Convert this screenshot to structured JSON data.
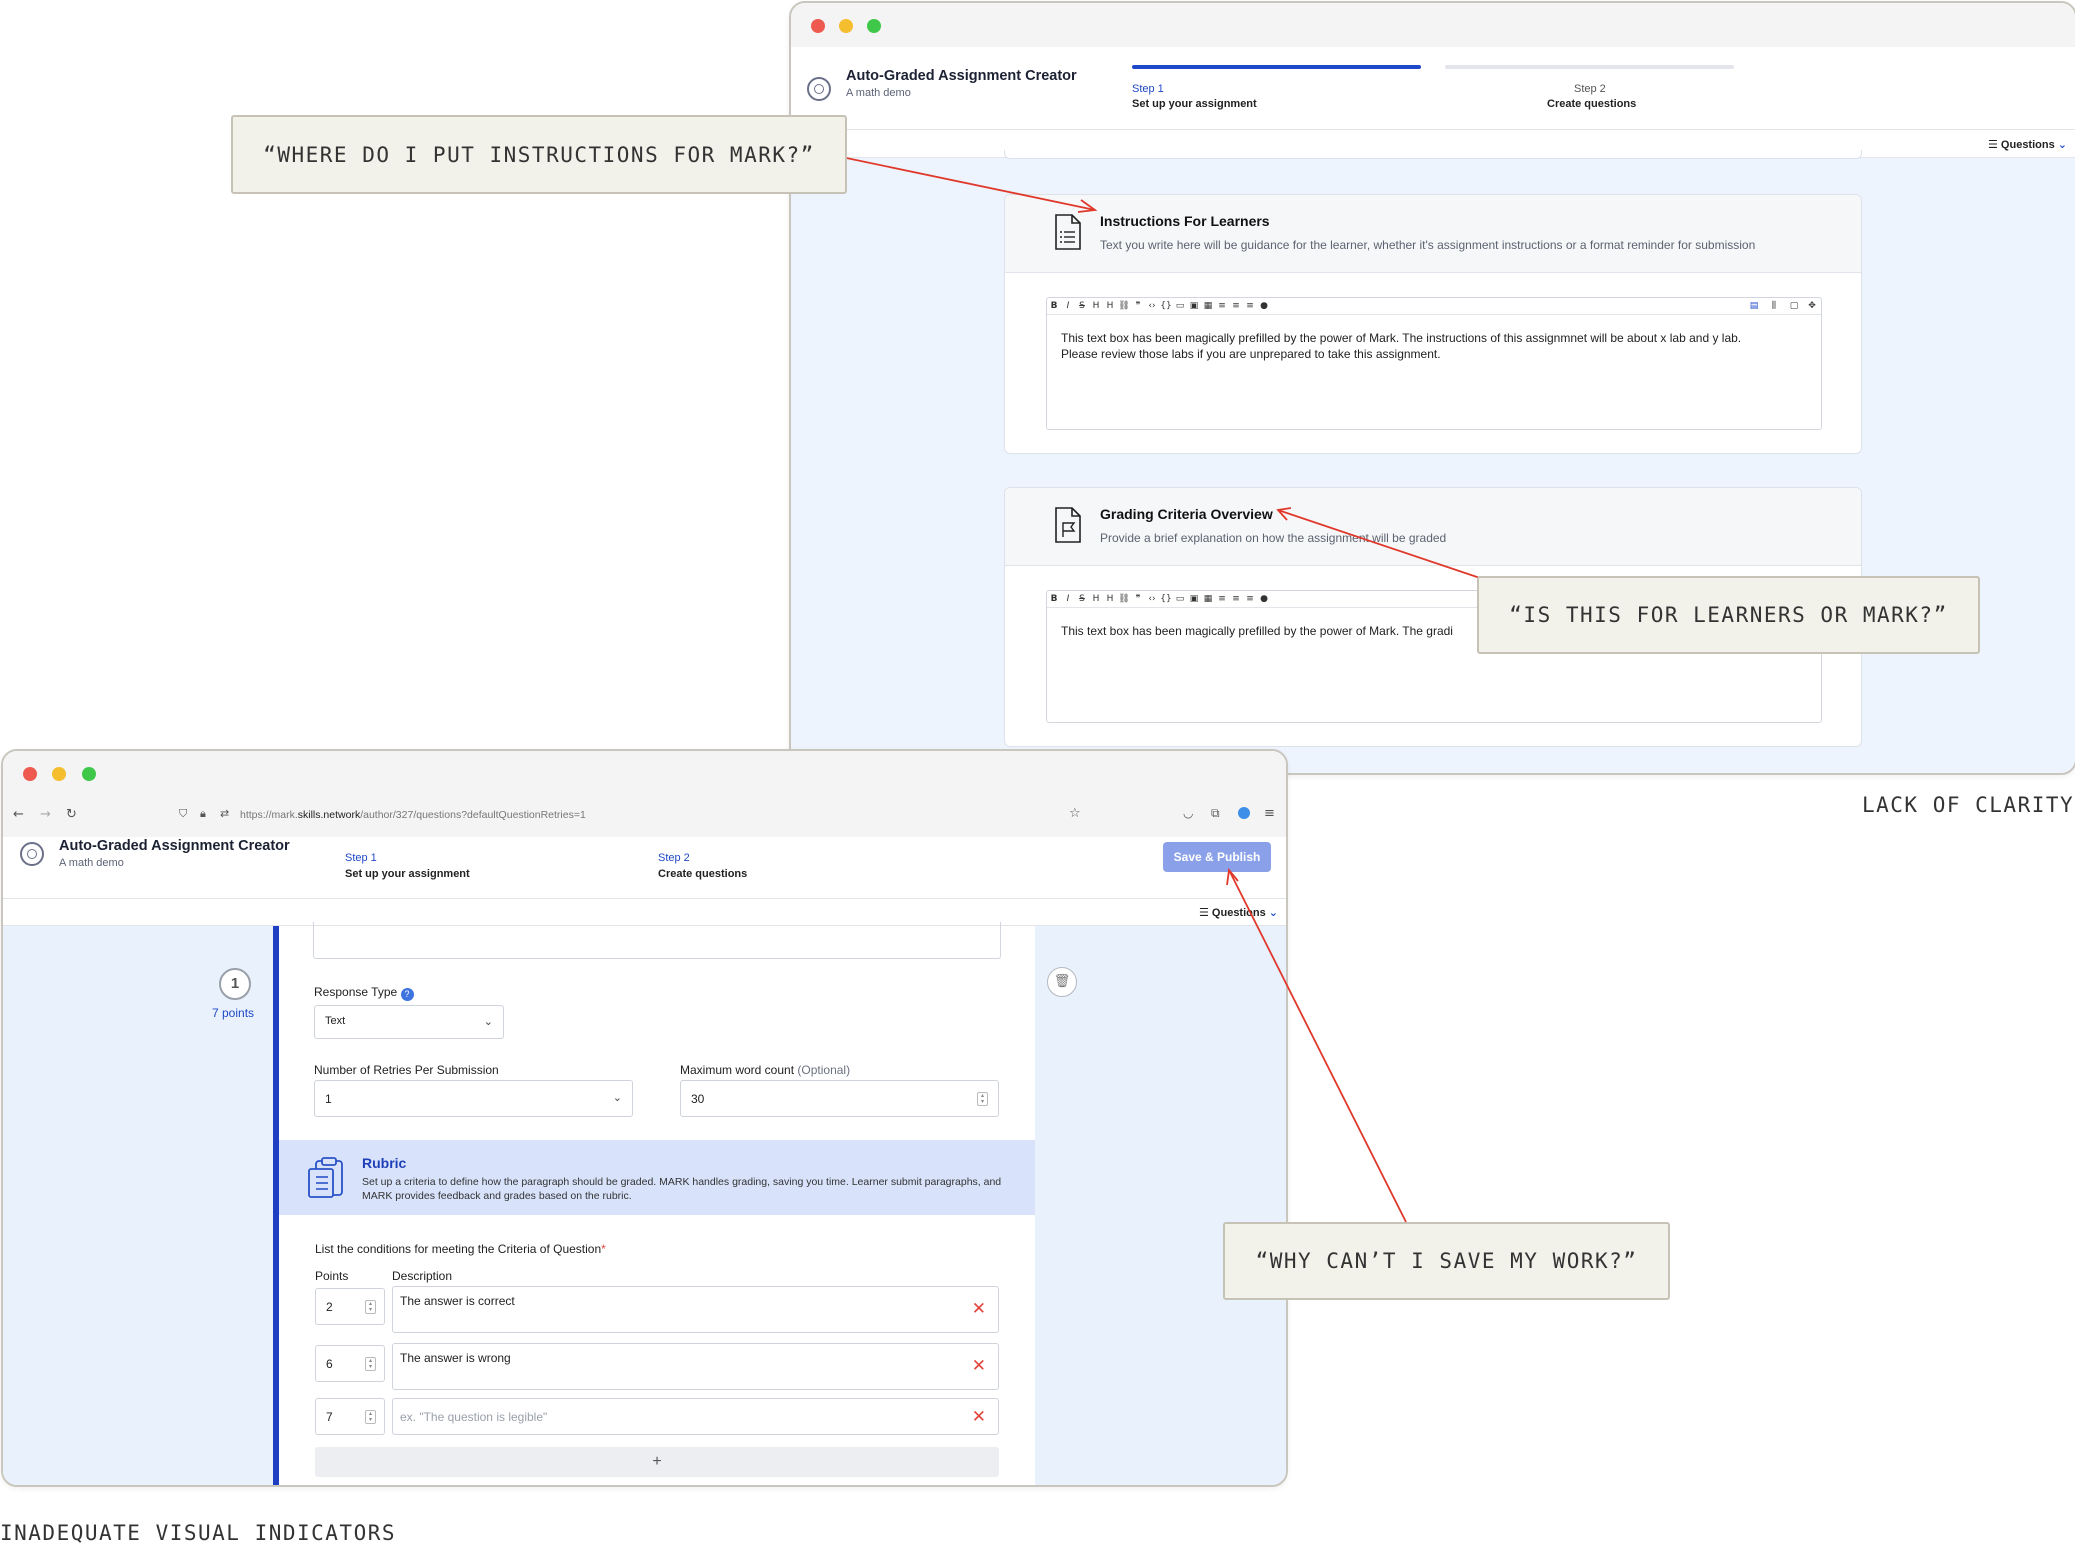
{
  "top_window": {
    "app_title": "Auto-Graded Assignment Creator",
    "app_subtitle": "A math demo",
    "step1_label": "Step 1",
    "step1_name": "Set up your assignment",
    "step2_label": "Step 2",
    "step2_name": "Create questions",
    "step1_progress": 1.0,
    "step2_progress": 0.0,
    "questions_button": "Questions",
    "instructions_card": {
      "title": "Instructions For Learners",
      "description": "Text you write here will be guidance for the learner, whether it's assignment instructions or a format reminder for submission",
      "text_line1": "This text box has been magically prefilled by the power of Mark. The instructions of this assignmnet will be about x lab and y lab.",
      "text_line2": "Please review those labs if you are unprepared to take this assignment."
    },
    "grading_card": {
      "title": "Grading Criteria Overview",
      "description": "Provide a brief explanation on how the assignment will be graded",
      "text_line1": "This text box has been magically prefilled by the power of Mark. The gradi"
    }
  },
  "bottom_window": {
    "url_prefix": "https://mark.",
    "url_domain": "skills.network",
    "url_path": "/author/327/questions?defaultQuestionRetries=1",
    "app_title": "Auto-Graded Assignment Creator",
    "app_subtitle": "A math demo",
    "step1_label": "Step 1",
    "step1_name": "Set up your assignment",
    "step2_label": "Step 2",
    "step2_name": "Create questions",
    "save_button": "Save & Publish",
    "questions_button": "Questions",
    "question_number": "1",
    "question_points": "7 points",
    "response_type_label": "Response Type",
    "response_type_value": "Text",
    "retries_label": "Number of Retries Per Submission",
    "retries_value": "1",
    "max_words_label": "Maximum word count",
    "max_words_optional": "(Optional)",
    "max_words_value": "30",
    "rubric_title": "Rubric",
    "rubric_desc_line1": "Set up a criteria to define how the paragraph should be graded. MARK handles grading, saving you time. Learner submit paragraphs, and",
    "rubric_desc_line2": "MARK provides feedback and grades based on the rubric.",
    "conditions_label": "List the conditions for meeting the Criteria of Question",
    "required_mark": "*",
    "points_header": "Points",
    "description_header": "Description",
    "criteria": [
      {
        "points": "2",
        "description": "The answer is correct",
        "placeholder": ""
      },
      {
        "points": "6",
        "description": "The answer is wrong",
        "placeholder": ""
      },
      {
        "points": "7",
        "description": "",
        "placeholder": "ex. \"The question is legible\""
      }
    ],
    "add_button": "+"
  },
  "annotations": {
    "callout1": "“WHERE DO I PUT INSTRUCTIONS FOR MARK?”",
    "callout2": "“IS THIS FOR LEARNERS OR MARK?”",
    "callout3": "“WHY CAN’T I SAVE MY WORK?”",
    "caption1": "LACK OF CLARITY",
    "caption2": "INADEQUATE VISUAL INDICATORS",
    "arrow_color": "#e0392b"
  },
  "colors": {
    "accent": "#1f49c8",
    "save_button_bg": "#8aa1ea",
    "rubric_bg": "#d8e3fb",
    "canvas_bg": "#eef4fd",
    "callout_bg": "#f2f1ea",
    "error_red": "#e0443a"
  }
}
